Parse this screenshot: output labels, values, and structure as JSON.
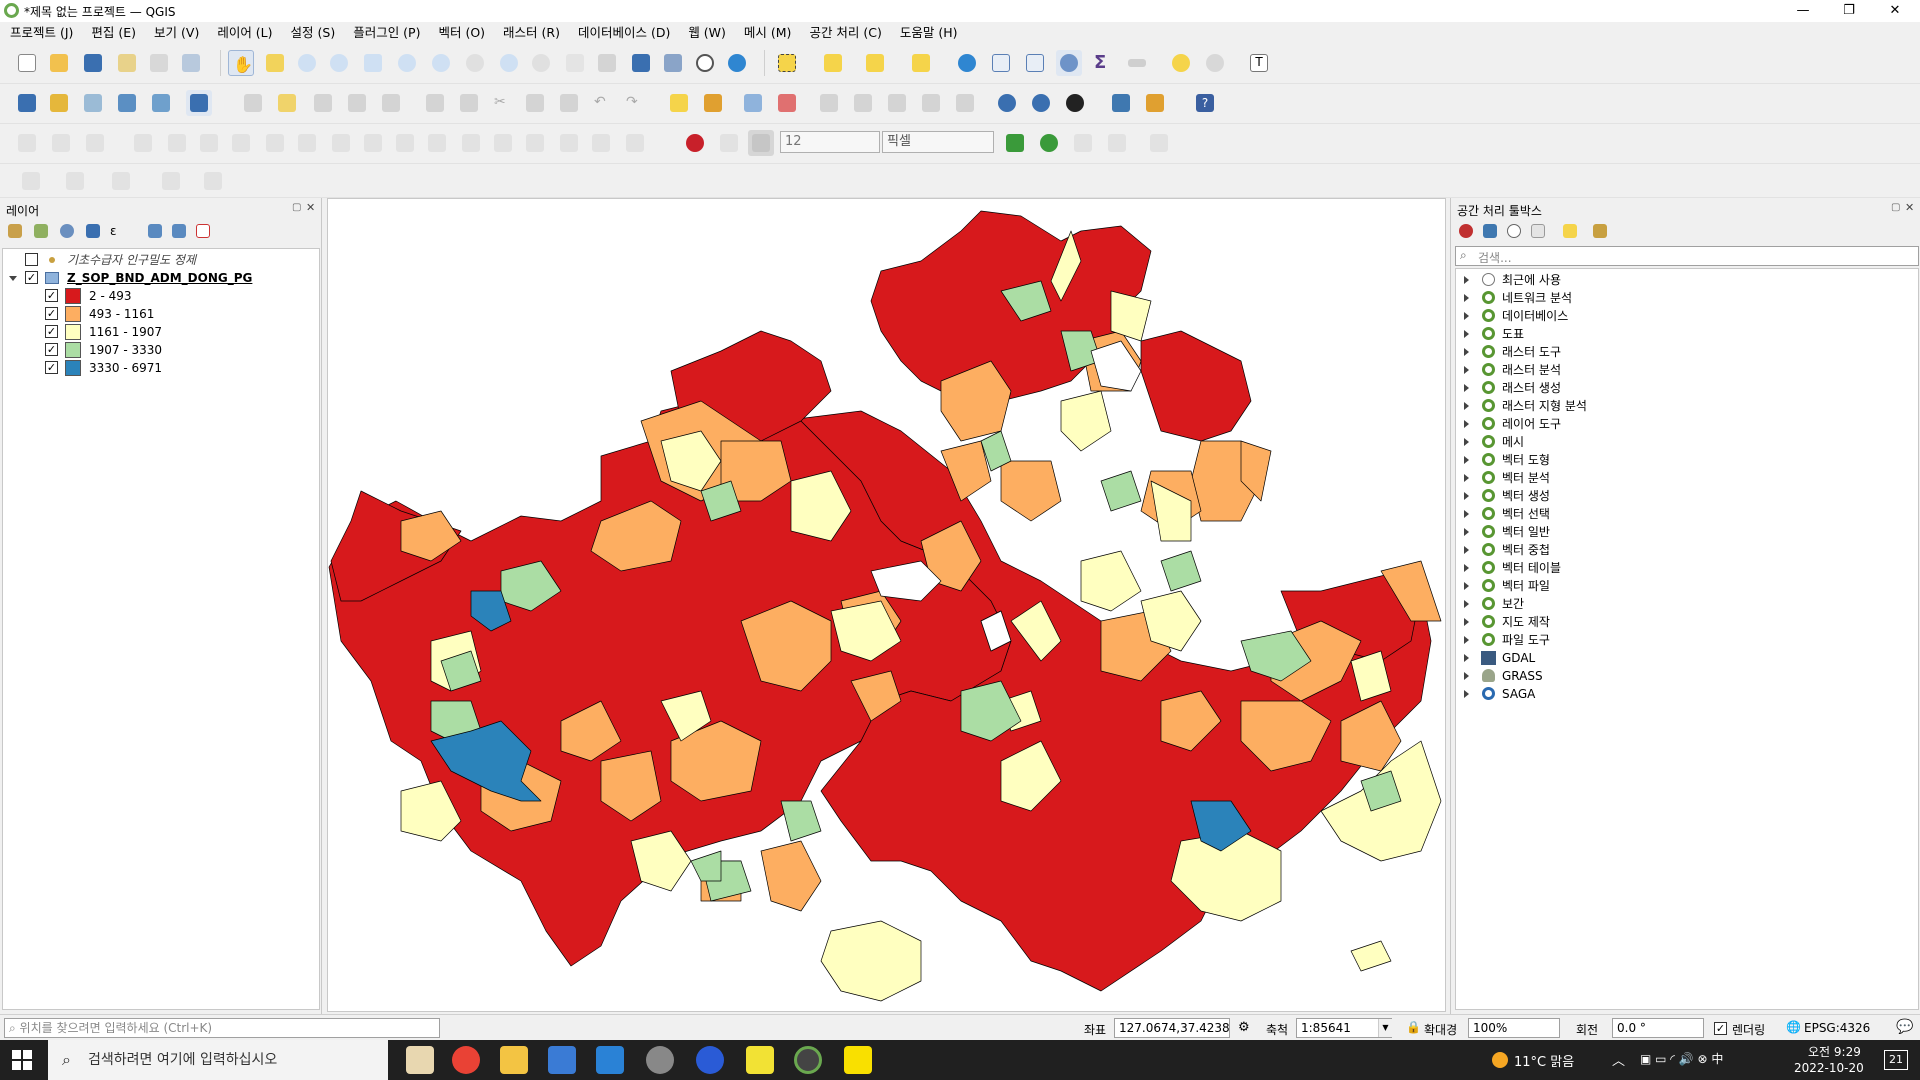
{
  "window": {
    "title": "*제목 없는 프로젝트 — QGIS",
    "minimize": "—",
    "maximize": "❐",
    "close": "✕"
  },
  "menu": [
    "프로젝트 (J)",
    "편집 (E)",
    "보기 (V)",
    "레이어 (L)",
    "설정 (S)",
    "플러그인 (P)",
    "벡터 (O)",
    "래스터 (R)",
    "데이터베이스 (D)",
    "웹 (W)",
    "메시 (M)",
    "공간 처리 (C)",
    "도움말 (H)"
  ],
  "digitizing": {
    "snap_tolerance": "12",
    "snap_units": "픽셀"
  },
  "layers_panel": {
    "title": "레이어",
    "layers": [
      {
        "name": "기초수급자 인구밀도 정제",
        "checked": false,
        "italic": true
      },
      {
        "name": "Z_SOP_BND_ADM_DONG_PG",
        "checked": true,
        "bold": true
      }
    ],
    "legend": [
      {
        "label": "2 - 493",
        "color": "#d7191c"
      },
      {
        "label": "493 - 1161",
        "color": "#fdae61"
      },
      {
        "label": "1161 - 1907",
        "color": "#ffffc0"
      },
      {
        "label": "1907 - 3330",
        "color": "#abdda4"
      },
      {
        "label": "3330 - 6971",
        "color": "#2b83ba"
      }
    ]
  },
  "toolbox_panel": {
    "title": "공간 처리 툴박스",
    "search_placeholder": "검색...",
    "items": [
      "최근에 사용",
      "네트워크 분석",
      "데이터베이스",
      "도표",
      "래스터 도구",
      "래스터 분석",
      "래스터 생성",
      "래스터 지형 분석",
      "레이어 도구",
      "메시",
      "벡터 도형",
      "벡터 분석",
      "벡터 생성",
      "벡터 선택",
      "벡터 일반",
      "벡터 중첩",
      "벡터 테이블",
      "벡터 파일",
      "보간",
      "지도 제작",
      "파일 도구",
      "GDAL",
      "GRASS",
      "SAGA"
    ]
  },
  "statusbar": {
    "locator_placeholder": "위치를 찾으려면 입력하세요 (Ctrl+K)",
    "coord_label": "좌표",
    "coord_value": "127.0674,37.4238",
    "scale_label": "축척",
    "scale_value": "1:85641",
    "magnifier_label": "확대경",
    "magnifier_value": "100%",
    "rotation_label": "회전",
    "rotation_value": "0.0 °",
    "render_label": "렌더링",
    "crs": "EPSG:4326"
  },
  "taskbar": {
    "search_placeholder": "검색하려면 여기에 입력하십시오",
    "weather": "11°C 맑음",
    "time": "오전 9:29",
    "date": "2022-10-20",
    "notifications": "21"
  }
}
